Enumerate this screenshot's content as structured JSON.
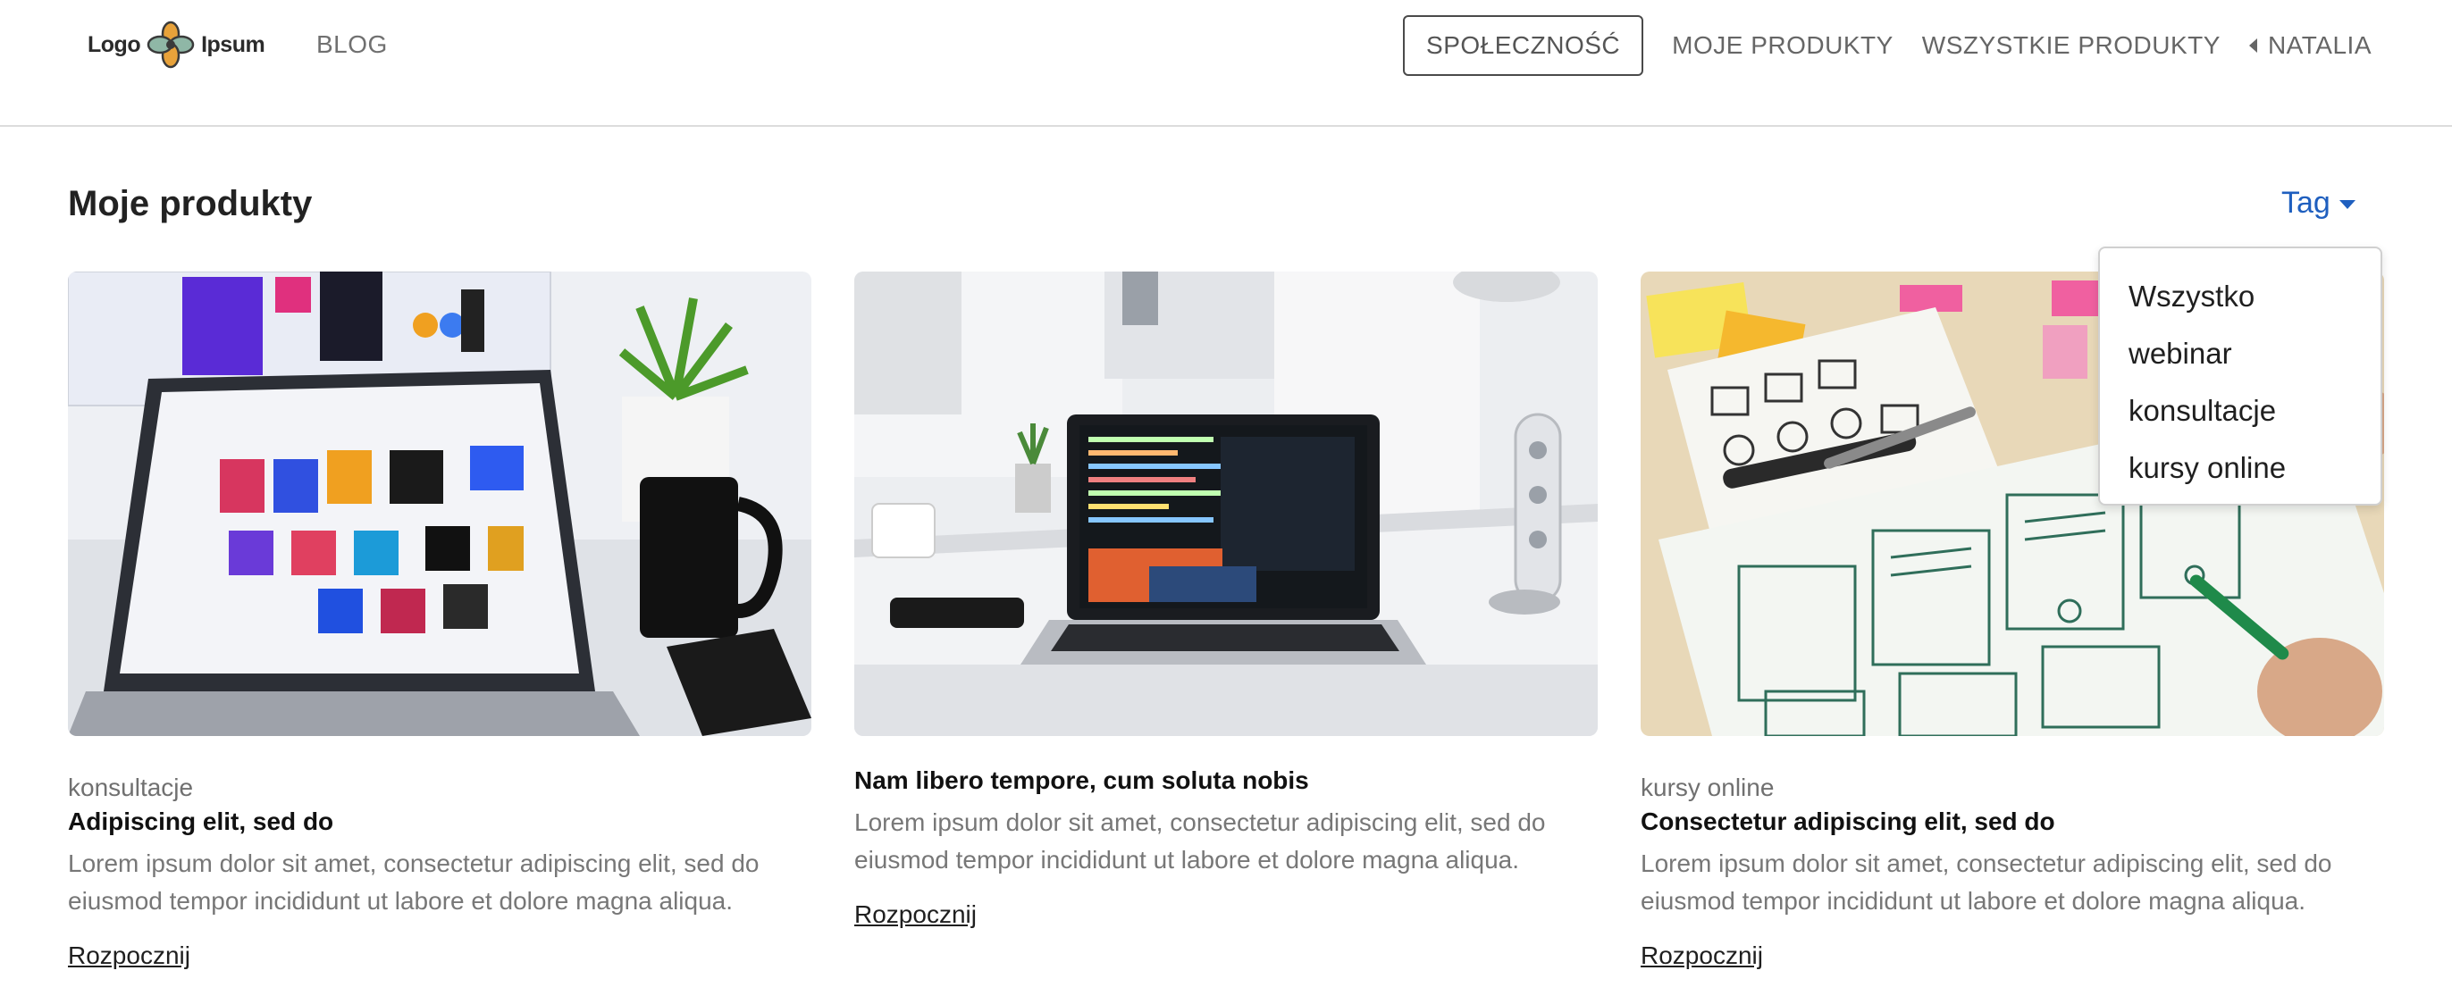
{
  "header": {
    "logo": {
      "text_left": "Logo",
      "text_right": "Ipsum"
    },
    "nav_left": {
      "blog": "BLOG"
    },
    "nav_right": {
      "community_button": "SPOŁECZNOŚĆ",
      "my_products": "MOJE PRODUKTY",
      "all_products": "WSZYSTKIE PRODUKTY",
      "user_name": "NATALIA"
    }
  },
  "main": {
    "title": "Moje produkty",
    "tag_filter": {
      "label": "Tag",
      "options": [
        "Wszystko",
        "webinar",
        "konsultacje",
        "kursy online"
      ]
    },
    "cards": [
      {
        "tag": "konsultacje",
        "title": "Adipiscing elit, sed do",
        "description": "Lorem ipsum dolor sit amet, consectetur adipiscing elit, sed do eiusmod tempor incididunt ut labore et dolore magna aliqua.",
        "link": "Rozpocznij",
        "image": "laptop-design-report-photo"
      },
      {
        "tag": "",
        "title": "Nam libero tempore, cum soluta nobis",
        "description": "Lorem ipsum dolor sit amet, consectetur adipiscing elit, sed do eiusmod tempor incididunt ut labore et dolore magna aliqua.",
        "link": "Rozpocznij",
        "image": "laptop-code-editor-photo"
      },
      {
        "tag": "kursy online",
        "title": "Consectetur adipiscing elit, sed do",
        "description": "Lorem ipsum dolor sit amet, consectetur adipiscing elit, sed do eiusmod tempor incididunt ut labore et dolore magna aliqua.",
        "link": "Rozpocznij",
        "image": "wireframe-sketches-photo"
      }
    ]
  },
  "colors": {
    "accent": "#1f5fbf",
    "text": "#1f1f1f",
    "muted": "#777777",
    "border": "#dcdcdc"
  }
}
